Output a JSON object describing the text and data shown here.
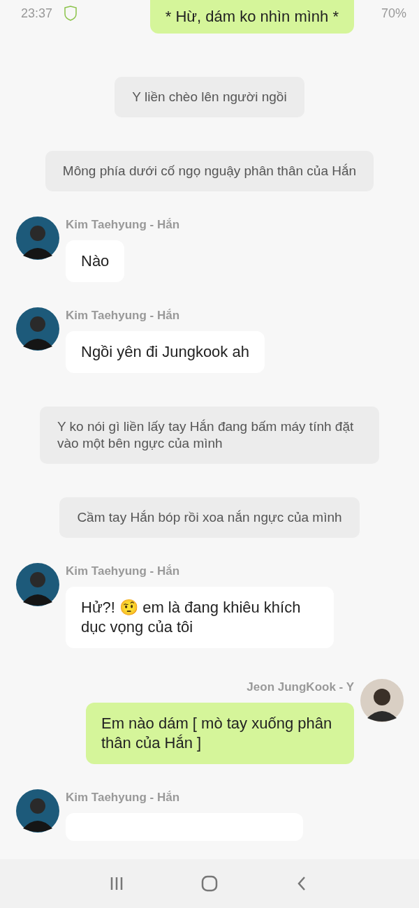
{
  "status_bar": {
    "time": "23:37",
    "battery": "70%"
  },
  "messages": [
    {
      "kind": "outgoing",
      "text": "* Hừ, dám ko nhìn mình *"
    },
    {
      "kind": "narration",
      "text": "Y liền chèo lên người ngồi"
    },
    {
      "kind": "narration",
      "text": "Mông phía dưới cố ngọ nguậy phân thân của Hắn"
    },
    {
      "kind": "incoming",
      "sender": "Kim Taehyung - Hắn",
      "text": "Nào"
    },
    {
      "kind": "incoming",
      "sender": "Kim Taehyung - Hắn",
      "text": "Ngồi yên đi Jungkook ah"
    },
    {
      "kind": "narration",
      "text": "Y ko nói gì liền lấy tay Hắn đang bấm máy tính đặt vào một bên ngực của mình"
    },
    {
      "kind": "narration",
      "text": "Cầm tay Hắn bóp rồi xoa nắn ngực của mình"
    },
    {
      "kind": "incoming",
      "sender": "Kim Taehyung - Hắn",
      "text": "Hử?! 🤨 em là đang khiêu khích dục vọng của tôi"
    },
    {
      "kind": "outgoing",
      "sender": "Jeon JungKook - Y",
      "text": "Em nào dám [ mò tay xuống phân thân của Hắn ]"
    },
    {
      "kind": "incoming",
      "sender": "Kim Taehyung - Hắn"
    }
  ]
}
